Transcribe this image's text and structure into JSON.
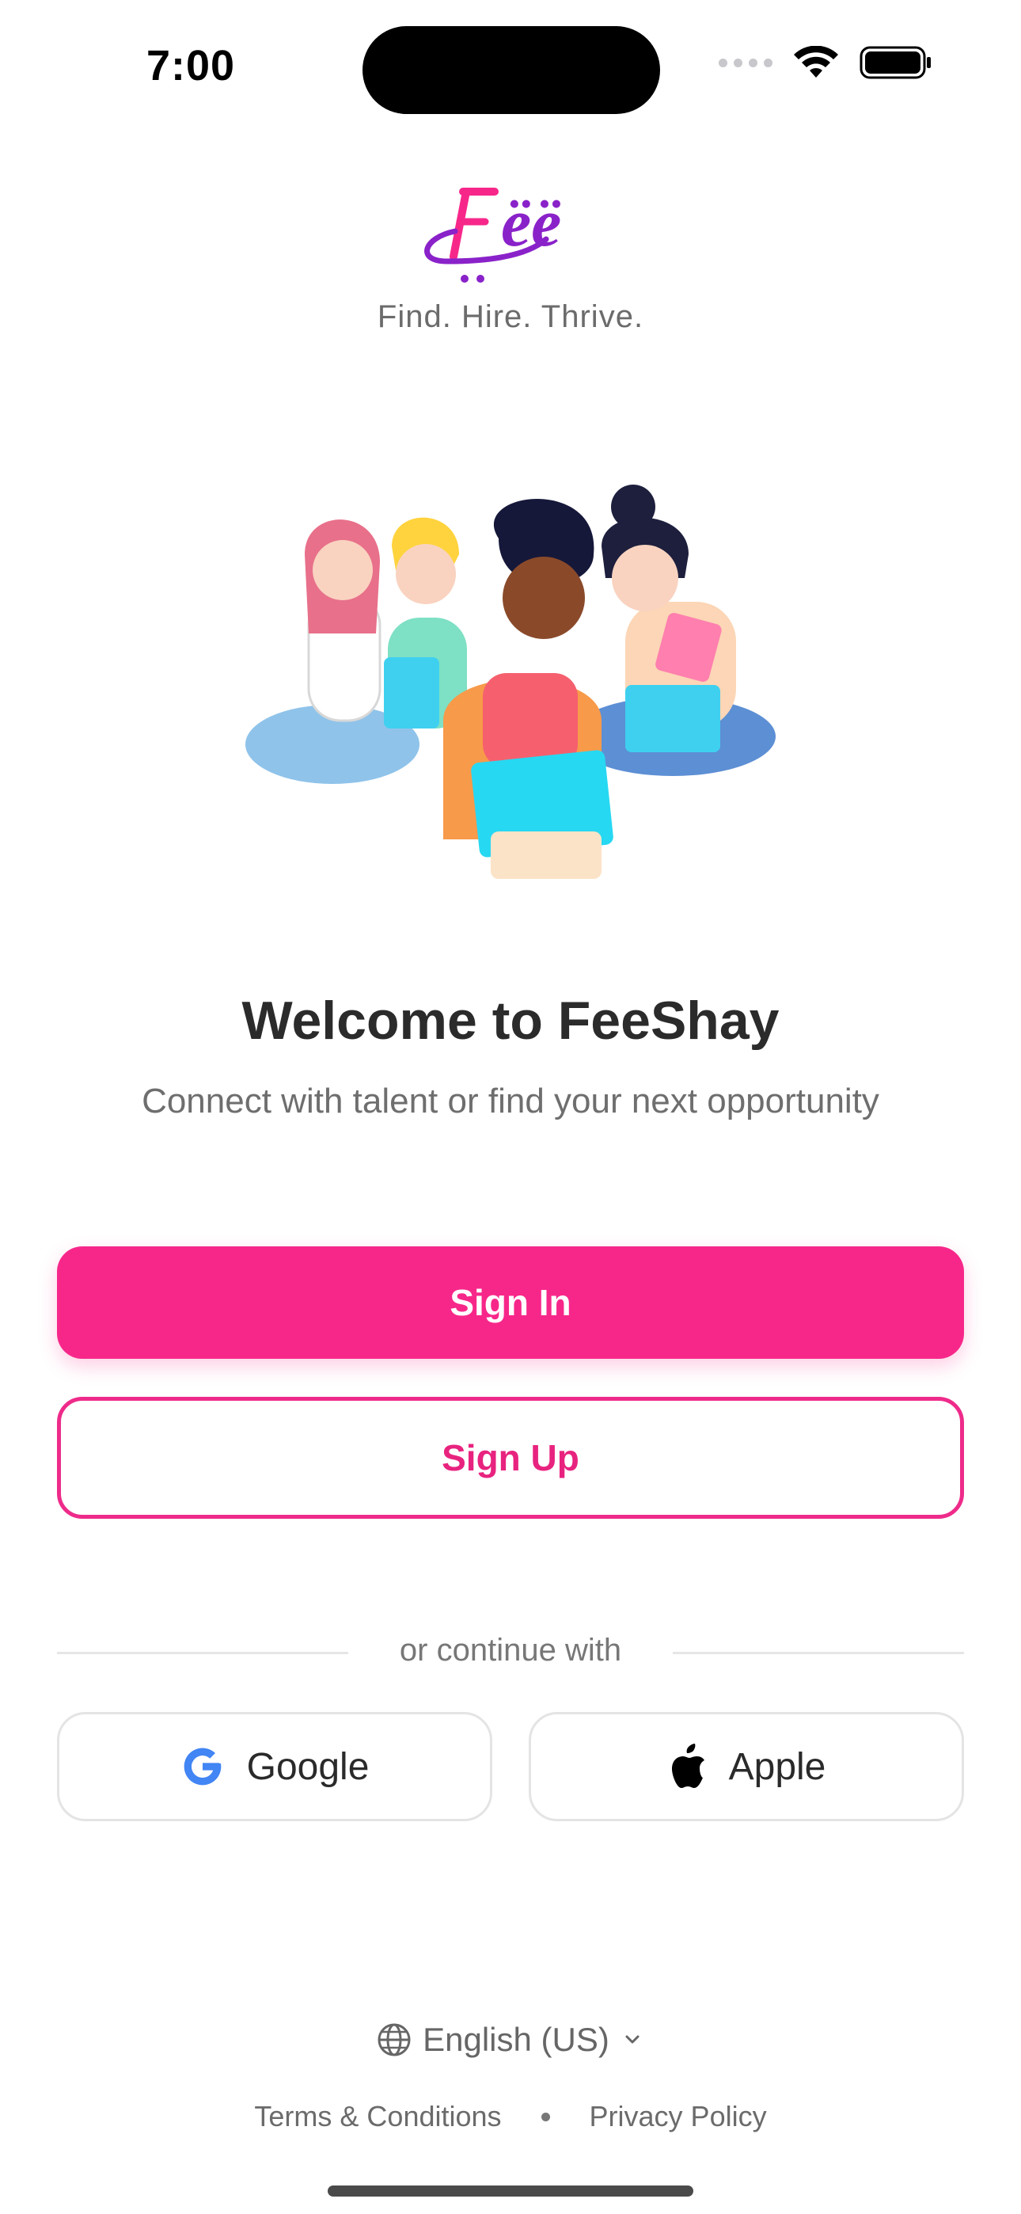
{
  "status_bar": {
    "time": "7:00"
  },
  "brand": {
    "logo_text": "Fëë",
    "tagline": "Find. Hire. Thrive.",
    "accent": "#f7278a",
    "purple": "#8a22c9"
  },
  "welcome": {
    "title": "Welcome to FeeShay",
    "subtitle": "Connect with talent or find your next opportunity"
  },
  "actions": {
    "sign_in": "Sign In",
    "sign_up": "Sign Up"
  },
  "divider": {
    "text": "or continue with"
  },
  "social": {
    "google": "Google",
    "apple": "Apple"
  },
  "footer": {
    "language": "English (US)",
    "terms": "Terms & Conditions",
    "privacy": "Privacy Policy"
  },
  "icons": [
    "wifi-icon",
    "battery-icon",
    "google-icon",
    "apple-icon",
    "globe-icon",
    "chevron-down-icon"
  ]
}
